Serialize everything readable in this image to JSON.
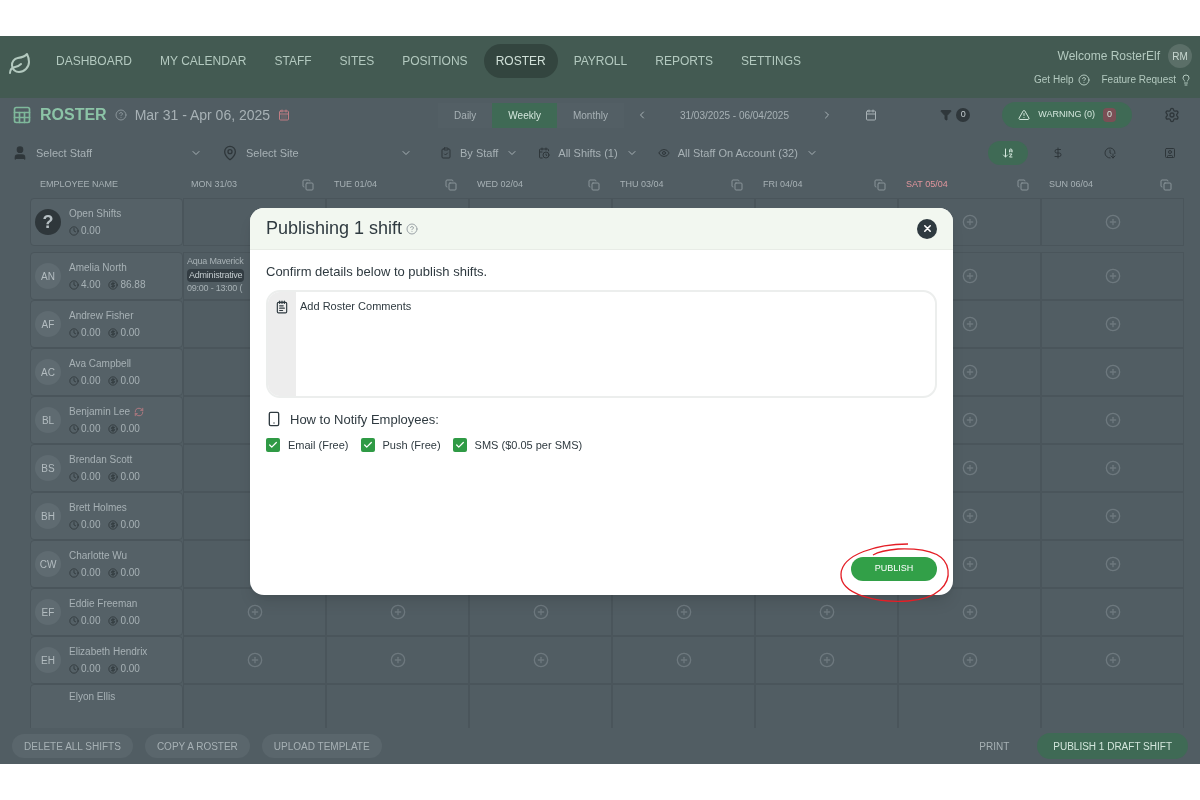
{
  "nav": {
    "items": [
      {
        "label": "DASHBOARD",
        "selected": false
      },
      {
        "label": "MY CALENDAR",
        "selected": false
      },
      {
        "label": "STAFF",
        "selected": false
      },
      {
        "label": "SITES",
        "selected": false
      },
      {
        "label": "POSITIONS",
        "selected": false
      },
      {
        "label": "ROSTER",
        "selected": true
      },
      {
        "label": "PAYROLL",
        "selected": false
      },
      {
        "label": "REPORTS",
        "selected": false
      },
      {
        "label": "SETTINGS",
        "selected": false
      }
    ],
    "welcome": "Welcome RosterElf",
    "avatar": "RM",
    "help": "Get Help",
    "feature": "Feature Request"
  },
  "roster": {
    "title": "ROSTER",
    "date_range": "Mar 31 - Apr 06, 2025",
    "views": [
      {
        "label": "Daily",
        "selected": false
      },
      {
        "label": "Weekly",
        "selected": true
      },
      {
        "label": "Monthly",
        "selected": false
      }
    ],
    "period": "31/03/2025 - 06/04/2025",
    "filter_count": "0",
    "warning": "WARNING (0)",
    "warning_count": "0"
  },
  "filters": {
    "staff_placeholder": "Select Staff",
    "site_placeholder": "Select Site",
    "group": "By Staff",
    "shifts": "All Shifts (1)",
    "visibility": "All Staff On Account (32)"
  },
  "table": {
    "employee_header": "EMPLOYEE NAME",
    "days": [
      {
        "label": "MON 31/03",
        "weekend": false
      },
      {
        "label": "TUE 01/04",
        "weekend": false
      },
      {
        "label": "WED 02/04",
        "weekend": false
      },
      {
        "label": "THU 03/04",
        "weekend": false
      },
      {
        "label": "FRI 04/04",
        "weekend": false
      },
      {
        "label": "SAT 05/04",
        "weekend": true
      },
      {
        "label": "SUN 06/04",
        "weekend": false
      }
    ],
    "rows": [
      {
        "kind": "open",
        "avatar": "?",
        "name": "Open Shifts",
        "hours": "0.00"
      },
      {
        "kind": "employee",
        "avatar": "AN",
        "name": "Amelia North",
        "hours": "4.00",
        "pay": "86.88",
        "alert": false,
        "shift": {
          "site": "Aqua Maverick",
          "position": "Administrative",
          "time": "09:00 - 13:00 ("
        }
      },
      {
        "kind": "employee",
        "avatar": "AF",
        "name": "Andrew Fisher",
        "hours": "0.00",
        "pay": "0.00",
        "alert": false
      },
      {
        "kind": "employee",
        "avatar": "AC",
        "name": "Ava Campbell",
        "hours": "0.00",
        "pay": "0.00",
        "alert": false
      },
      {
        "kind": "employee",
        "avatar": "BL",
        "name": "Benjamin Lee",
        "hours": "0.00",
        "pay": "0.00",
        "alert": true
      },
      {
        "kind": "employee",
        "avatar": "BS",
        "name": "Brendan Scott",
        "hours": "0.00",
        "pay": "0.00",
        "alert": false
      },
      {
        "kind": "employee",
        "avatar": "BH",
        "name": "Brett Holmes",
        "hours": "0.00",
        "pay": "0.00",
        "alert": false
      },
      {
        "kind": "employee",
        "avatar": "CW",
        "name": "Charlotte Wu",
        "hours": "0.00",
        "pay": "0.00",
        "alert": false
      },
      {
        "kind": "employee",
        "avatar": "EF",
        "name": "Eddie Freeman",
        "hours": "0.00",
        "pay": "0.00",
        "alert": false
      },
      {
        "kind": "employee",
        "avatar": "EH",
        "name": "Elizabeth Hendrix",
        "hours": "0.00",
        "pay": "0.00",
        "alert": false
      },
      {
        "kind": "partial",
        "name": "Elyon Ellis"
      }
    ]
  },
  "bottom": {
    "left": [
      "DELETE ALL SHIFTS",
      "COPY A ROSTER",
      "UPLOAD TEMPLATE"
    ],
    "print": "PRINT",
    "publish": "PUBLISH 1 DRAFT SHIFT"
  },
  "modal": {
    "title": "Publishing 1 shift",
    "intro": "Confirm details below to publish shifts.",
    "comments_placeholder": "Add Roster Comments",
    "notify_label": "How to Notify Employees:",
    "channels": [
      {
        "label": "Email (Free)",
        "checked": true
      },
      {
        "label": "Push (Free)",
        "checked": true
      },
      {
        "label": "SMS ($0.05 per SMS)",
        "checked": true
      }
    ],
    "button": "PUBLISH",
    "annotation": true
  }
}
